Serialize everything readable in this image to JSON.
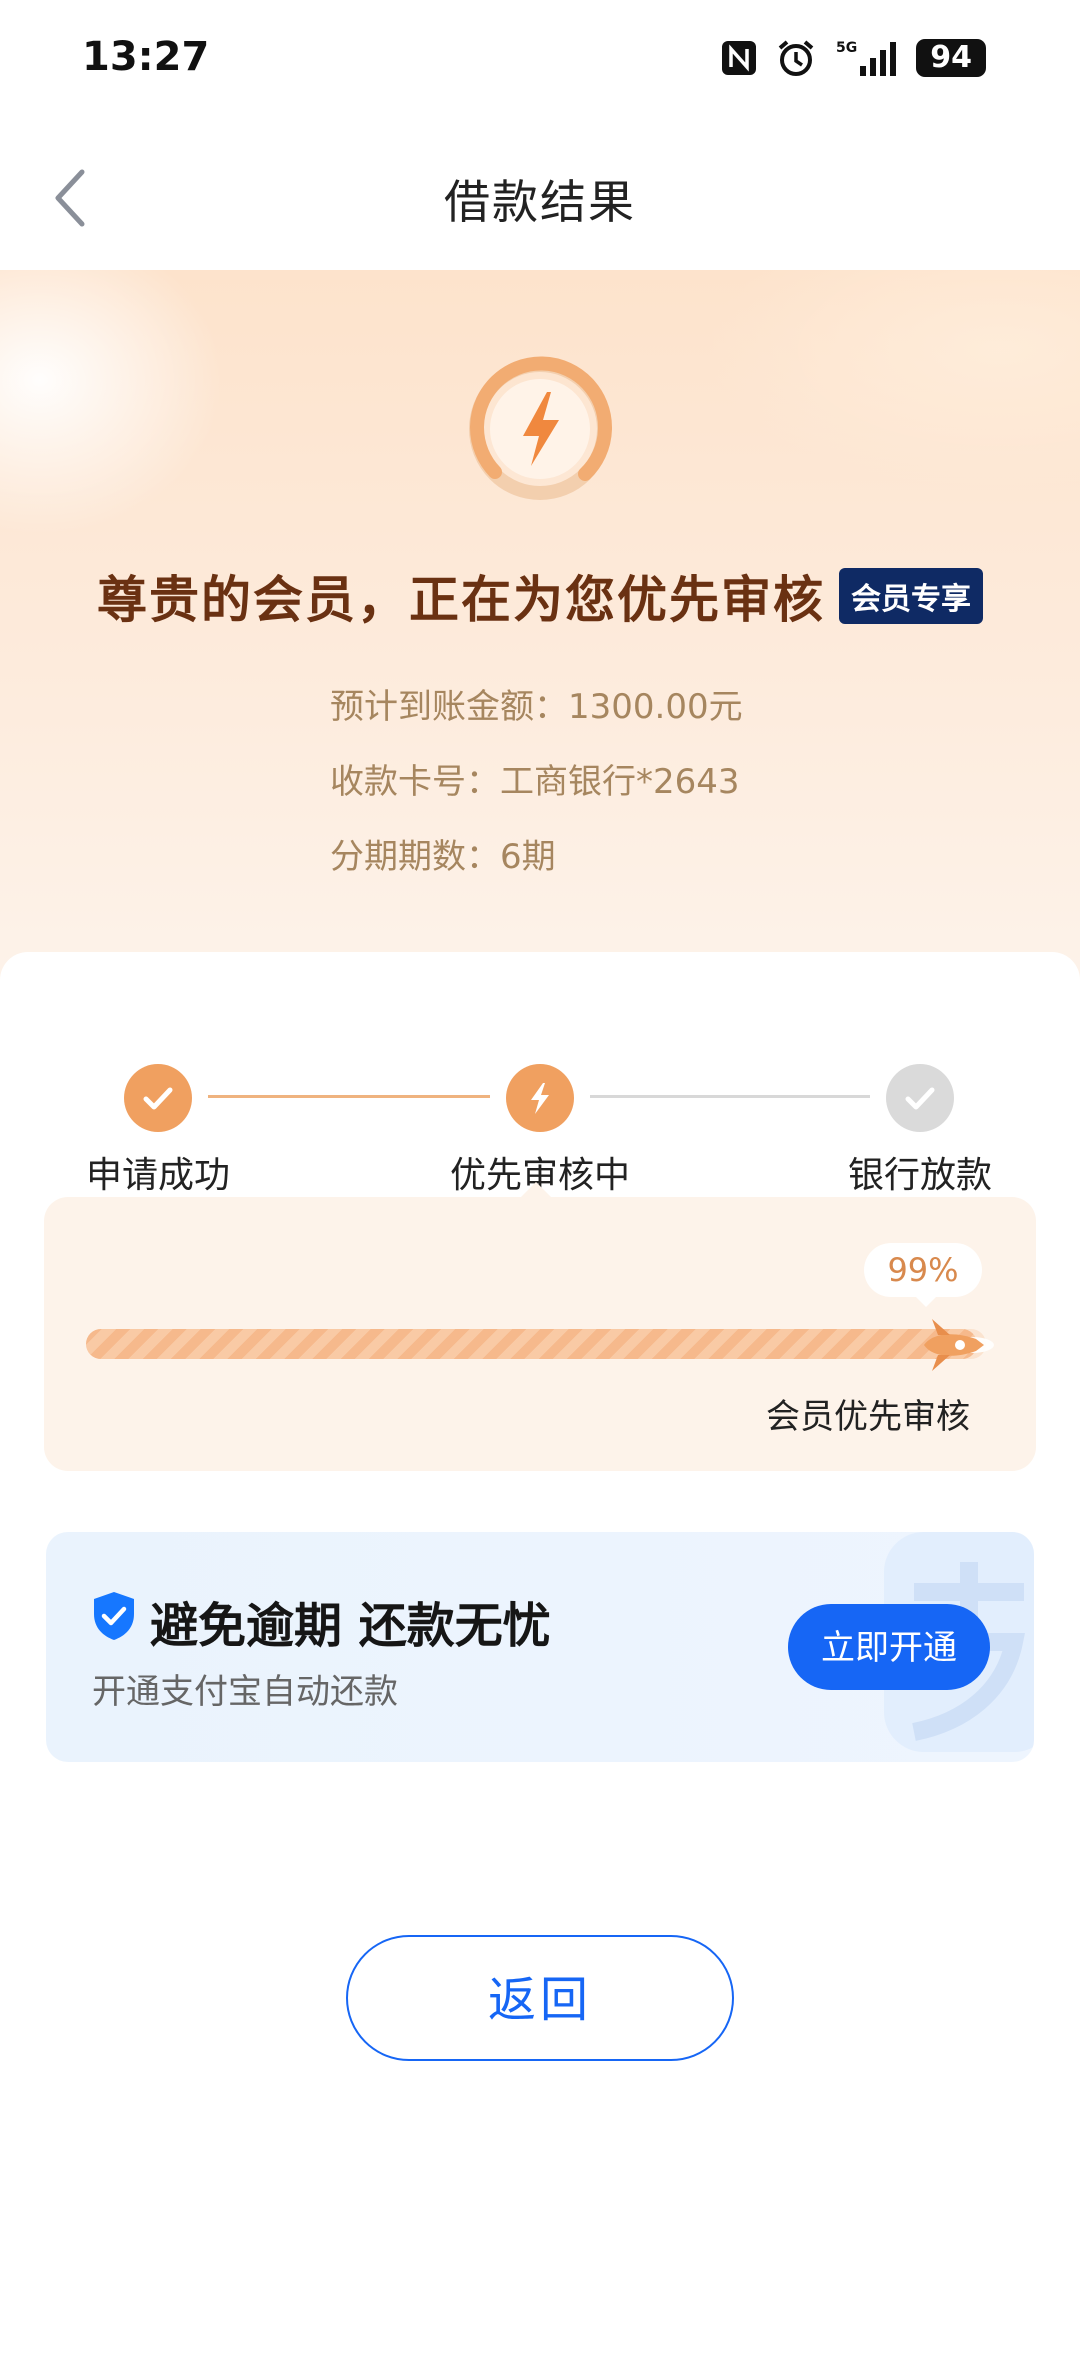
{
  "status_bar": {
    "time": "13:27",
    "icons": [
      "nfc-icon",
      "alarm-icon",
      "signal-5g-icon"
    ],
    "battery": "94"
  },
  "nav": {
    "title": "借款结果",
    "back_icon": "chevron-left-icon"
  },
  "hero": {
    "icon": "lightning-icon",
    "title": "尊贵的会员，正在为您优先审核",
    "member_tag": "会员专享",
    "info": [
      "预计到账金额：1300.00元",
      "收款卡号：工商银行*2643",
      "分期期数：6期"
    ]
  },
  "steps": [
    {
      "label": "申请成功",
      "state": "done"
    },
    {
      "label": "优先审核中",
      "state": "active"
    },
    {
      "label": "银行放款",
      "state": "pending"
    }
  ],
  "progress": {
    "percent_text": "99%",
    "fraction": 0.99,
    "label": "会员优先审核"
  },
  "promo": {
    "title": "避免逾期 还款无忧",
    "subtitle": "开通支付宝自动还款",
    "button": "立即开通"
  },
  "return_button": "返回",
  "colors": {
    "accent_orange": "#f0a060",
    "brand_blue": "#1666f5",
    "title_brown": "#6a3112",
    "info_tan": "#a6865f"
  }
}
